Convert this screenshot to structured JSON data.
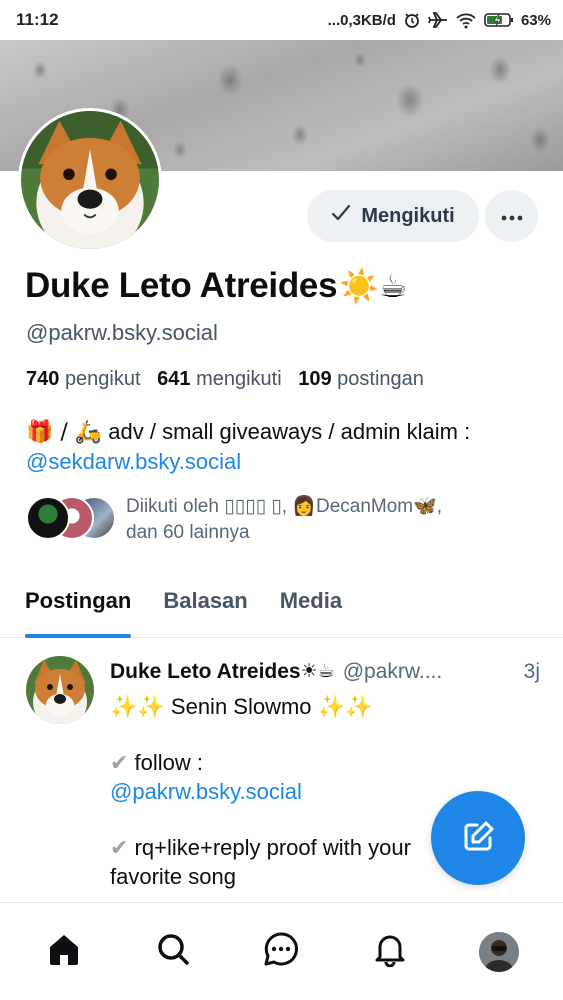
{
  "status_bar": {
    "time": "11:12",
    "network_speed": "...0,3KB/d",
    "battery": "63%",
    "icons": [
      "alarm-icon",
      "airplane-icon",
      "wifi-icon",
      "battery-charging-icon"
    ]
  },
  "profile": {
    "follow_button_label": "Mengikuti",
    "more_button_icon": "ellipsis-icon",
    "display_name": "Duke Leto Atreides",
    "display_name_emoji": "☀️☕",
    "handle": "@pakrw.bsky.social",
    "stats": {
      "followers_count": "740",
      "followers_label": "pengikut",
      "following_count": "641",
      "following_label": "mengikuti",
      "posts_count": "109",
      "posts_label": "postingan"
    },
    "bio_line1_emoji": "🎁 / 🛵",
    "bio_line1_text": " adv / small giveaways / admin klaim :",
    "bio_link": "@sekdarw.bsky.social",
    "followed_by_text": "Diikuti oleh ▯▯▯▯ ▯, 👩DecanMom🦋,",
    "followed_by_text2": "dan 60 lainnya"
  },
  "tabs": [
    {
      "label": "Postingan",
      "active": true
    },
    {
      "label": "Balasan",
      "active": false
    },
    {
      "label": "Media",
      "active": false
    }
  ],
  "post": {
    "author_name": "Duke Leto Atreides",
    "author_emoji": "☀☕",
    "author_handle": "@pakrw....",
    "time": "3j",
    "line1_spark_left": "✨✨",
    "line1_text": " Senin Slowmo ",
    "line1_spark_right": "✨✨",
    "line2_check": "✔",
    "line2_text": " follow :",
    "line3_link": "@pakrw.bsky.social",
    "line4_check": "✔",
    "line4_text": " rq+like+reply proof with your",
    "line5_text": "favorite song"
  },
  "fab": {
    "icon": "compose-icon"
  },
  "bottom_nav": [
    "home-icon",
    "search-icon",
    "chat-icon",
    "notifications-icon",
    "profile-avatar"
  ],
  "colors": {
    "accent": "#1d86e6",
    "muted_text": "#475566",
    "button_bg": "#eef1f4"
  }
}
